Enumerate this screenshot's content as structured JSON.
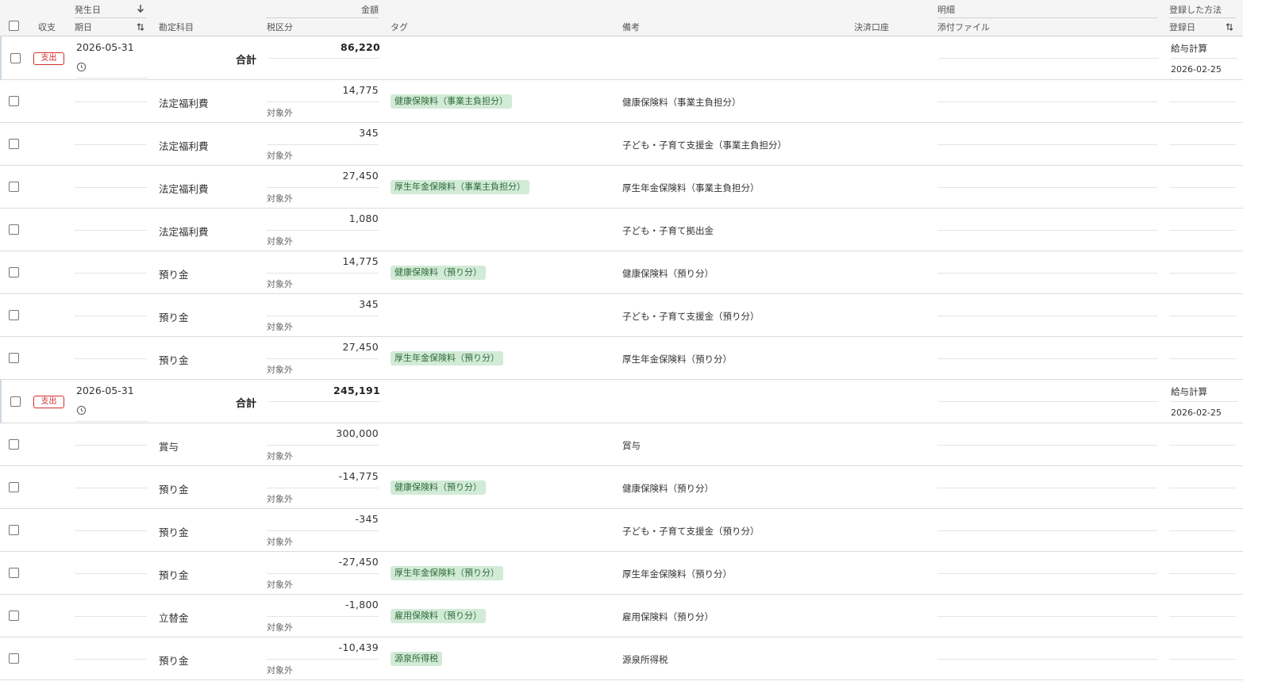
{
  "header": {
    "top_labels": {
      "occurred": "発生日",
      "amount": "金額",
      "detail": "明細",
      "registered_method": "登録した方法"
    },
    "columns": {
      "income_expense": "収支",
      "due_date": "期日",
      "account": "勘定科目",
      "tax_category": "税区分",
      "tag": "タグ",
      "memo": "備考",
      "payment_account": "決済口座",
      "attachment": "添付ファイル",
      "registered_date": "登録日"
    }
  },
  "groups": [
    {
      "type_badge": "支出",
      "date": "2026-05-31",
      "total_label": "合計",
      "total": "86,220",
      "method": "給与計算",
      "registered_date": "2026-02-25",
      "lines": [
        {
          "account": "法定福利費",
          "amount": "14,775",
          "tax": "対象外",
          "tag": "健康保険料（事業主負担分）",
          "memo": "健康保険料（事業主負担分）"
        },
        {
          "account": "法定福利費",
          "amount": "345",
          "tax": "対象外",
          "tag": "",
          "memo": "子ども・子育て支援金（事業主負担分）"
        },
        {
          "account": "法定福利費",
          "amount": "27,450",
          "tax": "対象外",
          "tag": "厚生年金保険料（事業主負担分）",
          "memo": "厚生年金保険料（事業主負担分）"
        },
        {
          "account": "法定福利費",
          "amount": "1,080",
          "tax": "対象外",
          "tag": "",
          "memo": "子ども・子育て拠出金"
        },
        {
          "account": "預り金",
          "amount": "14,775",
          "tax": "対象外",
          "tag": "健康保険料（預り分）",
          "memo": "健康保険料（預り分）"
        },
        {
          "account": "預り金",
          "amount": "345",
          "tax": "対象外",
          "tag": "",
          "memo": "子ども・子育て支援金（預り分）"
        },
        {
          "account": "預り金",
          "amount": "27,450",
          "tax": "対象外",
          "tag": "厚生年金保険料（預り分）",
          "memo": "厚生年金保険料（預り分）"
        }
      ]
    },
    {
      "type_badge": "支出",
      "date": "2026-05-31",
      "total_label": "合計",
      "total": "245,191",
      "method": "給与計算",
      "registered_date": "2026-02-25",
      "lines": [
        {
          "account": "賞与",
          "amount": "300,000",
          "tax": "対象外",
          "tag": "",
          "memo": "賞与"
        },
        {
          "account": "預り金",
          "amount": "-14,775",
          "tax": "対象外",
          "tag": "健康保険料（預り分）",
          "memo": "健康保険料（預り分）"
        },
        {
          "account": "預り金",
          "amount": "-345",
          "tax": "対象外",
          "tag": "",
          "memo": "子ども・子育て支援金（預り分）"
        },
        {
          "account": "預り金",
          "amount": "-27,450",
          "tax": "対象外",
          "tag": "厚生年金保険料（預り分）",
          "memo": "厚生年金保険料（預り分）"
        },
        {
          "account": "立替金",
          "amount": "-1,800",
          "tax": "対象外",
          "tag": "雇用保険料（預り分）",
          "memo": "雇用保険料（預り分）"
        },
        {
          "account": "預り金",
          "amount": "-10,439",
          "tax": "対象外",
          "tag": "源泉所得税",
          "memo": "源泉所得税"
        }
      ]
    }
  ],
  "colors": {
    "badge": "#d32f2f",
    "tag_bg": "#d2ebd7",
    "tag_text": "#2e6b3a",
    "header_bg": "#f5f5f5"
  },
  "icons": {
    "sort_desc": "arrow-down-icon",
    "sort_toggle": "sort-arrows-icon",
    "recurring": "clock-icon"
  }
}
